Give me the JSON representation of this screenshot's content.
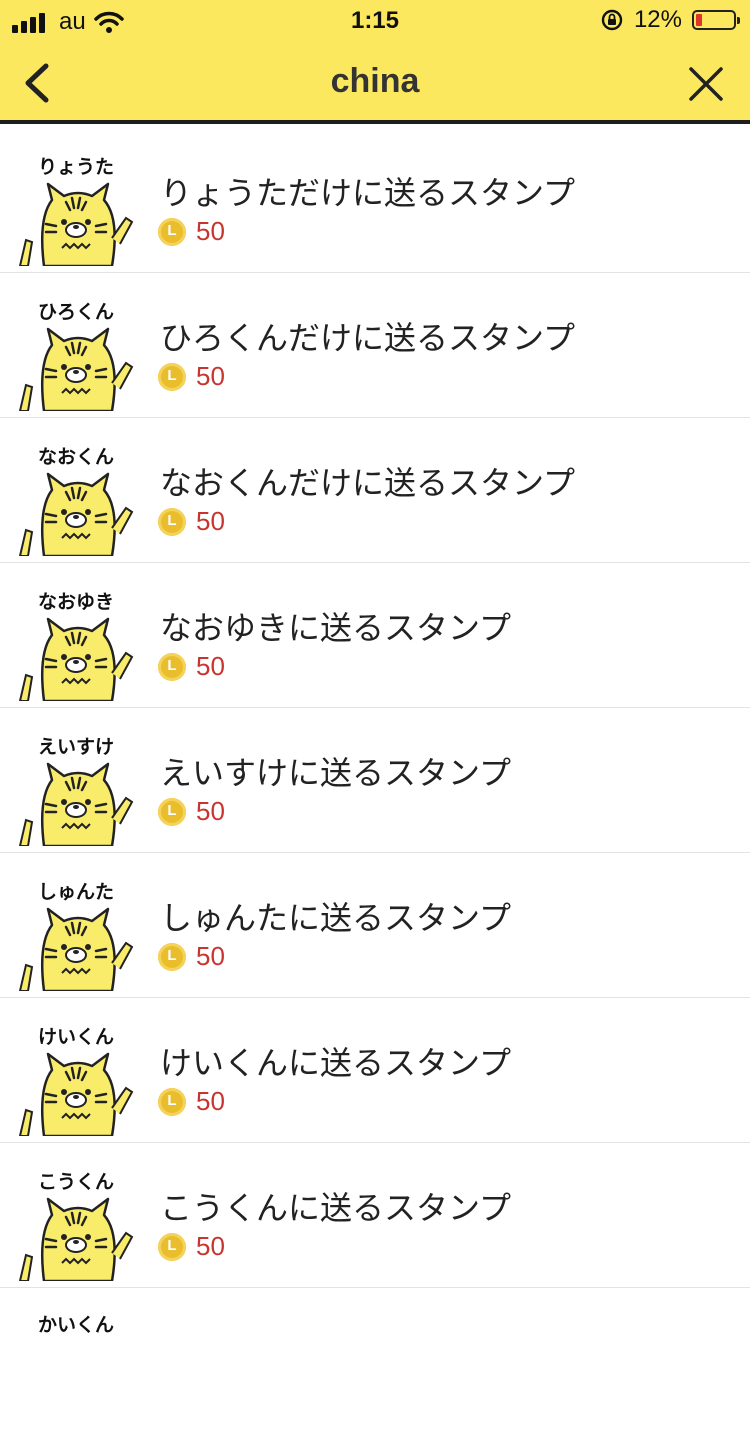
{
  "status_bar": {
    "carrier": "au",
    "time": "1:15",
    "battery_percent": "12%"
  },
  "nav": {
    "title": "china"
  },
  "items": [
    {
      "thumb_label": "りょうた",
      "title": "りょうただけに送るスタンプ",
      "price": "50",
      "coin_letter": "L"
    },
    {
      "thumb_label": "ひろくん",
      "title": "ひろくんだけに送るスタンプ",
      "price": "50",
      "coin_letter": "L"
    },
    {
      "thumb_label": "なおくん",
      "title": "なおくんだけに送るスタンプ",
      "price": "50",
      "coin_letter": "L"
    },
    {
      "thumb_label": "なおゆき",
      "title": "なおゆきに送るスタンプ",
      "price": "50",
      "coin_letter": "L"
    },
    {
      "thumb_label": "えいすけ",
      "title": "えいすけに送るスタンプ",
      "price": "50",
      "coin_letter": "L"
    },
    {
      "thumb_label": "しゅんた",
      "title": "しゅんたに送るスタンプ",
      "price": "50",
      "coin_letter": "L"
    },
    {
      "thumb_label": "けいくん",
      "title": "けいくんに送るスタンプ",
      "price": "50",
      "coin_letter": "L"
    },
    {
      "thumb_label": "こうくん",
      "title": "こうくんに送るスタンプ",
      "price": "50",
      "coin_letter": "L"
    }
  ],
  "partial_row_label": "かいくん",
  "colors": {
    "header_bg": "#fbe85f",
    "price_text": "#c8352f",
    "coin": "#e9bd2c",
    "tiger_yellow": "#f9ec6a"
  }
}
